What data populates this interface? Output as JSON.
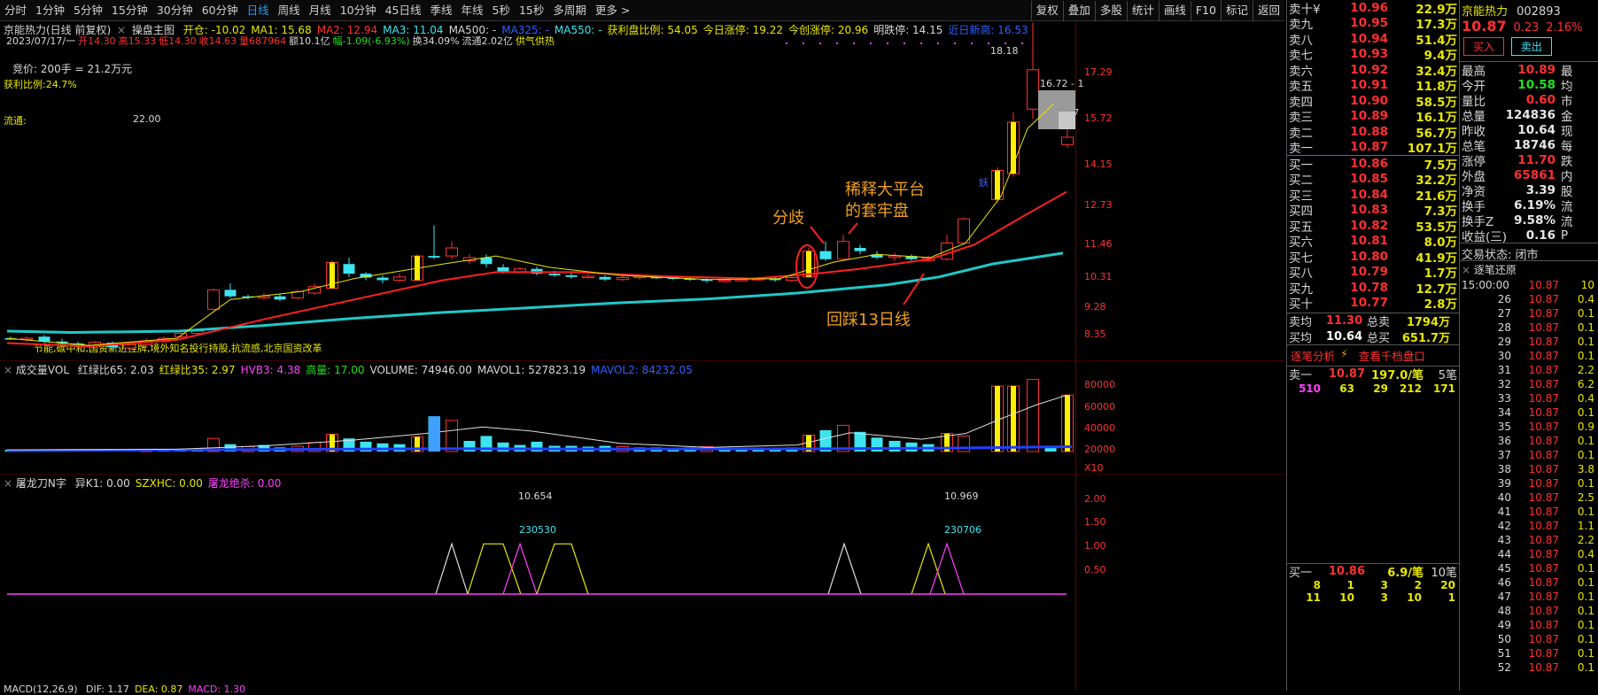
{
  "toolbar": {
    "periods": [
      "分时",
      "1分钟",
      "5分钟",
      "15分钟",
      "30分钟",
      "60分钟",
      "日线",
      "周线",
      "月线",
      "10分钟",
      "45日线",
      "季线",
      "年线",
      "5秒",
      "15秒",
      "多周期",
      "更多 >"
    ],
    "active_period": "日线",
    "tools": [
      "复权",
      "叠加",
      "多股",
      "统计",
      "画线",
      "F10",
      "标记",
      "返回"
    ]
  },
  "main": {
    "title": "京能热力(日线 前复权)",
    "subtitle": "操盘主图",
    "indicators": [
      {
        "t": "开仓: -10.02",
        "c": "yel"
      },
      {
        "t": "MA1: 15.68",
        "c": "yel"
      },
      {
        "t": "MA2: 12.94",
        "c": "red"
      },
      {
        "t": "MA3: 11.04",
        "c": "cyan"
      },
      {
        "t": "MA500: -",
        "c": "wht"
      },
      {
        "t": "MA325: -",
        "c": "blu"
      },
      {
        "t": "MA550: -",
        "c": "cyan"
      },
      {
        "t": "获利盘比例: 54.05",
        "c": "yel"
      },
      {
        "t": "今日涨停: 19.22",
        "c": "yel"
      },
      {
        "t": "今创涨停: 20.96",
        "c": "yel"
      },
      {
        "t": "明跌停: 14.15",
        "c": "wht"
      },
      {
        "t": "近日新高: 16.53",
        "c": "blu"
      }
    ],
    "day_line": [
      {
        "t": "2023/07/17/一",
        "c": "wht"
      },
      {
        "t": "开14.30",
        "c": "red"
      },
      {
        "t": "高15.33",
        "c": "red"
      },
      {
        "t": "低14.30",
        "c": "red"
      },
      {
        "t": "收14.63",
        "c": "red"
      },
      {
        "t": "量687964",
        "c": "red"
      },
      {
        "t": "额10.1亿",
        "c": "wht"
      },
      {
        "t": "幅-1.09(-6.93%)",
        "c": "grn"
      },
      {
        "t": "换34.09%",
        "c": "wht"
      },
      {
        "t": "流通2.02亿",
        "c": "wht"
      },
      {
        "t": "供气供热",
        "c": "yel"
      }
    ],
    "auction": "竞价: 200手 = 21.2万元",
    "profit_ratio": "获利比例:24.7%",
    "float_label": "流通:",
    "float_value": "22.00",
    "concepts": "节能,碳中和,国资新进挂牌,境外知名投行持股,抗流感,北京国资改革",
    "annotations": {
      "fenqi": "分歧",
      "platform_1": "稀释大平台",
      "platform_2": "的套牢盘",
      "pullback": "回踩13日线",
      "yao": "妖"
    },
    "price_labels": {
      "high": "18.18",
      "mid": "16.72 - 1",
      "ma": "15.7"
    },
    "y_ticks": [
      "17.29",
      "15.72",
      "14.15",
      "12.73",
      "11.46",
      "10.31",
      "9.28",
      "8.35"
    ]
  },
  "volume": {
    "title": "成交量VOL",
    "indicators": [
      {
        "t": "红绿比65: 2.03",
        "c": "wht"
      },
      {
        "t": "红绿比35: 2.97",
        "c": "yel"
      },
      {
        "t": "HVB3: 4.38",
        "c": "mag"
      },
      {
        "t": "高量: 17.00",
        "c": "grn"
      },
      {
        "t": "VOLUME: 74946.00",
        "c": "wht"
      },
      {
        "t": "MAVOL1: 527823.19",
        "c": "wht"
      },
      {
        "t": "MAVOL2: 84232.05",
        "c": "blu"
      }
    ],
    "y_ticks": [
      "80000",
      "60000",
      "40000",
      "20000",
      "X10"
    ]
  },
  "sub": {
    "title": "屠龙刀N字",
    "indicators": [
      {
        "t": "异K1: 0.00",
        "c": "wht"
      },
      {
        "t": "SZXHC: 0.00",
        "c": "yel"
      },
      {
        "t": "屠龙绝杀: 0.00",
        "c": "mag"
      }
    ],
    "labels": [
      "10.654",
      "230530",
      "10.969",
      "230706"
    ],
    "y_ticks": [
      "2.00",
      "1.50",
      "1.00",
      "0.50"
    ]
  },
  "macd": {
    "title": "MACD(12,26,9)",
    "indicators": [
      {
        "t": "DIF: 1.17",
        "c": "wht"
      },
      {
        "t": "DEA: 0.87",
        "c": "yel"
      },
      {
        "t": "MACD: 1.30",
        "c": "mag"
      }
    ]
  },
  "orderbook": {
    "asks": [
      {
        "label": "卖十",
        "price": "10.96",
        "vol": "22.9万",
        "mark": "¥"
      },
      {
        "label": "卖九",
        "price": "10.95",
        "vol": "17.3万"
      },
      {
        "label": "卖八",
        "price": "10.94",
        "vol": "51.4万"
      },
      {
        "label": "卖七",
        "price": "10.93",
        "vol": "9.4万"
      },
      {
        "label": "卖六",
        "price": "10.92",
        "vol": "32.4万"
      },
      {
        "label": "卖五",
        "price": "10.91",
        "vol": "11.8万"
      },
      {
        "label": "卖四",
        "price": "10.90",
        "vol": "58.5万"
      },
      {
        "label": "卖三",
        "price": "10.89",
        "vol": "16.1万"
      },
      {
        "label": "卖二",
        "price": "10.88",
        "vol": "56.7万"
      },
      {
        "label": "卖一",
        "price": "10.87",
        "vol": "107.1万"
      }
    ],
    "bids": [
      {
        "label": "买一",
        "price": "10.86",
        "vol": "7.5万"
      },
      {
        "label": "买二",
        "price": "10.85",
        "vol": "32.2万"
      },
      {
        "label": "买三",
        "price": "10.84",
        "vol": "21.6万"
      },
      {
        "label": "买四",
        "price": "10.83",
        "vol": "7.3万"
      },
      {
        "label": "买五",
        "price": "10.82",
        "vol": "53.5万"
      },
      {
        "label": "买六",
        "price": "10.81",
        "vol": "8.0万"
      },
      {
        "label": "买七",
        "price": "10.80",
        "vol": "41.9万"
      },
      {
        "label": "买八",
        "price": "10.79",
        "vol": "1.7万"
      },
      {
        "label": "买九",
        "price": "10.78",
        "vol": "12.7万"
      },
      {
        "label": "买十",
        "price": "10.77",
        "vol": "2.8万"
      }
    ],
    "avg_sell_label": "卖均",
    "avg_sell": "11.30",
    "total_sell_label": "总卖",
    "total_sell": "1794万",
    "avg_buy_label": "买均",
    "avg_buy": "10.64",
    "total_buy_label": "总买",
    "total_buy": "651.7万",
    "analysis_tab": "逐笔分析",
    "level_tab": "查看千档盘口",
    "sell1": {
      "label": "卖一",
      "price": "10.87",
      "per": "197.0/笔",
      "count": "5笔",
      "queue": [
        "510",
        "63",
        "29",
        "212",
        "171"
      ]
    },
    "buy1": {
      "label": "买一",
      "price": "10.86",
      "per": "6.9/笔",
      "count": "10笔",
      "queue": [
        "8",
        "1",
        "3",
        "2",
        "20",
        "11",
        "10",
        "3",
        "10",
        "1"
      ]
    }
  },
  "stock": {
    "name": "京能热力",
    "code": "002893",
    "price": "10.87",
    "change": "0.23",
    "pct": "2.16%",
    "buy_btn": "买入",
    "sell_btn": "卖出",
    "rows": [
      {
        "l": "最高",
        "v": "10.89",
        "c": "red",
        "x": "最"
      },
      {
        "l": "今开",
        "v": "10.58",
        "c": "grn",
        "x": "均"
      },
      {
        "l": "量比",
        "v": "0.60",
        "c": "red",
        "x": "市"
      },
      {
        "l": "总量",
        "v": "124836",
        "c": "wht",
        "x": "金"
      },
      {
        "l": "昨收",
        "v": "10.64",
        "c": "wht",
        "x": "现"
      },
      {
        "l": "总笔",
        "v": "18746",
        "c": "wht",
        "x": "每"
      },
      {
        "l": "涨停",
        "v": "11.70",
        "c": "red",
        "x": "跌"
      },
      {
        "l": "外盘",
        "v": "65861",
        "c": "red",
        "x": "内"
      },
      {
        "l": "净资",
        "v": "3.39",
        "c": "wht",
        "x": "股"
      },
      {
        "l": "换手",
        "v": "6.19%",
        "c": "wht",
        "x": "流"
      },
      {
        "l": "换手Z",
        "v": "9.58%",
        "c": "wht",
        "x": "流"
      },
      {
        "l": "收益(三)",
        "v": "0.16",
        "c": "wht",
        "x": "P"
      }
    ],
    "status_label": "交易状态:",
    "status": "闭市",
    "ticks_title": "逐笔还原",
    "ticks": [
      {
        "t": "15:00:00",
        "p": "10.87",
        "v": "10"
      },
      {
        "t": "26",
        "p": "10.87",
        "v": "0.4"
      },
      {
        "t": "27",
        "p": "10.87",
        "v": "0.1"
      },
      {
        "t": "28",
        "p": "10.87",
        "v": "0.1"
      },
      {
        "t": "29",
        "p": "10.87",
        "v": "0.1"
      },
      {
        "t": "30",
        "p": "10.87",
        "v": "0.1"
      },
      {
        "t": "31",
        "p": "10.87",
        "v": "2.2"
      },
      {
        "t": "32",
        "p": "10.87",
        "v": "6.2"
      },
      {
        "t": "33",
        "p": "10.87",
        "v": "0.4"
      },
      {
        "t": "34",
        "p": "10.87",
        "v": "0.1"
      },
      {
        "t": "35",
        "p": "10.87",
        "v": "0.9"
      },
      {
        "t": "36",
        "p": "10.87",
        "v": "0.1"
      },
      {
        "t": "37",
        "p": "10.87",
        "v": "0.1"
      },
      {
        "t": "38",
        "p": "10.87",
        "v": "3.8"
      },
      {
        "t": "39",
        "p": "10.87",
        "v": "0.1"
      },
      {
        "t": "40",
        "p": "10.87",
        "v": "2.5"
      },
      {
        "t": "41",
        "p": "10.87",
        "v": "0.1"
      },
      {
        "t": "42",
        "p": "10.87",
        "v": "1.1"
      },
      {
        "t": "43",
        "p": "10.87",
        "v": "2.2"
      },
      {
        "t": "44",
        "p": "10.87",
        "v": "0.4"
      },
      {
        "t": "45",
        "p": "10.87",
        "v": "0.1"
      },
      {
        "t": "46",
        "p": "10.87",
        "v": "0.1"
      },
      {
        "t": "47",
        "p": "10.87",
        "v": "0.1"
      },
      {
        "t": "48",
        "p": "10.87",
        "v": "0.1"
      },
      {
        "t": "49",
        "p": "10.87",
        "v": "0.1"
      },
      {
        "t": "50",
        "p": "10.87",
        "v": "0.1"
      },
      {
        "t": "51",
        "p": "10.87",
        "v": "0.1"
      },
      {
        "t": "52",
        "p": "10.87",
        "v": "0.1"
      }
    ]
  },
  "colors": {
    "up": "#ff3030",
    "down": "#3ee4f0",
    "ma_fast": "#e8e800",
    "ma_mid": "#ff2020",
    "ma_slow": "#20c8c8",
    "annotation": "#f0a020"
  }
}
